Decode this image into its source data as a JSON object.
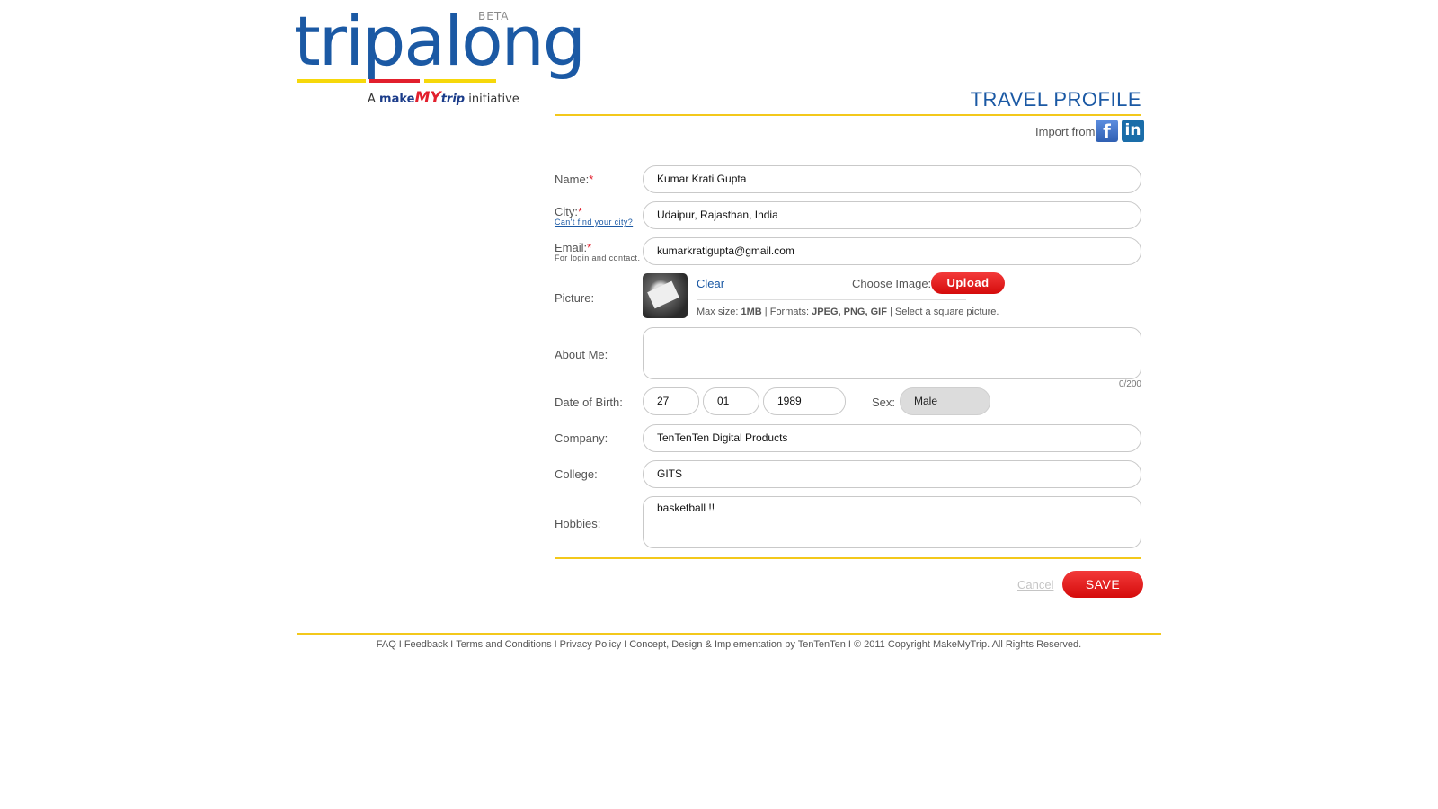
{
  "logo": {
    "word": "tripalong",
    "beta": "BETA",
    "tag_prefix": "A",
    "tag_make": "make",
    "tag_my": "MY",
    "tag_trip": "trip",
    "tag_suffix": "initiative"
  },
  "header": {
    "title": "TRAVEL PROFILE"
  },
  "import": {
    "label": "Import from",
    "facebook_icon": "facebook-icon",
    "linkedin_icon": "linkedin-icon"
  },
  "form": {
    "name": {
      "label": "Name:",
      "required": "*",
      "value": "Kumar Krati Gupta"
    },
    "city": {
      "label": "City:",
      "required": "*",
      "help_link": "Can't find your city?",
      "value": "Udaipur, Rajasthan, India"
    },
    "email": {
      "label": "Email:",
      "required": "*",
      "note": "For login and contact.",
      "value": "kumarkratigupta@gmail.com"
    },
    "picture": {
      "label": "Picture:",
      "clear": "Clear",
      "choose_label": "Choose Image:",
      "upload_button": "Upload",
      "help_prefix": "Max size: ",
      "max_size": "1MB",
      "help_formats_prefix": " | Formats: ",
      "formats": "JPEG, PNG, GIF",
      "help_suffix": " | Select a square picture."
    },
    "about": {
      "label": "About Me:",
      "value": "",
      "counter": "0/200"
    },
    "dob": {
      "label": "Date of Birth:",
      "day": "27",
      "month": "01",
      "year": "1989"
    },
    "sex": {
      "label": "Sex:",
      "value": "Male"
    },
    "company": {
      "label": "Company:",
      "value": "TenTenTen Digital Products"
    },
    "college": {
      "label": "College:",
      "value": "GITS"
    },
    "hobbies": {
      "label": "Hobbies:",
      "value": "basketball !!"
    }
  },
  "actions": {
    "cancel": "Cancel",
    "save": "SAVE"
  },
  "footer": {
    "links": [
      "FAQ",
      "Feedback",
      "Terms and Conditions",
      "Privacy Policy",
      "Concept, Design & Implementation by TenTenTen",
      "© 2011 Copyright MakeMyTrip. All Rights Reserved."
    ],
    "separator": "I"
  },
  "colors": {
    "brand_blue": "#1b59a4",
    "accent_red": "#e21f2d",
    "accent_yellow": "#f3c81b"
  }
}
